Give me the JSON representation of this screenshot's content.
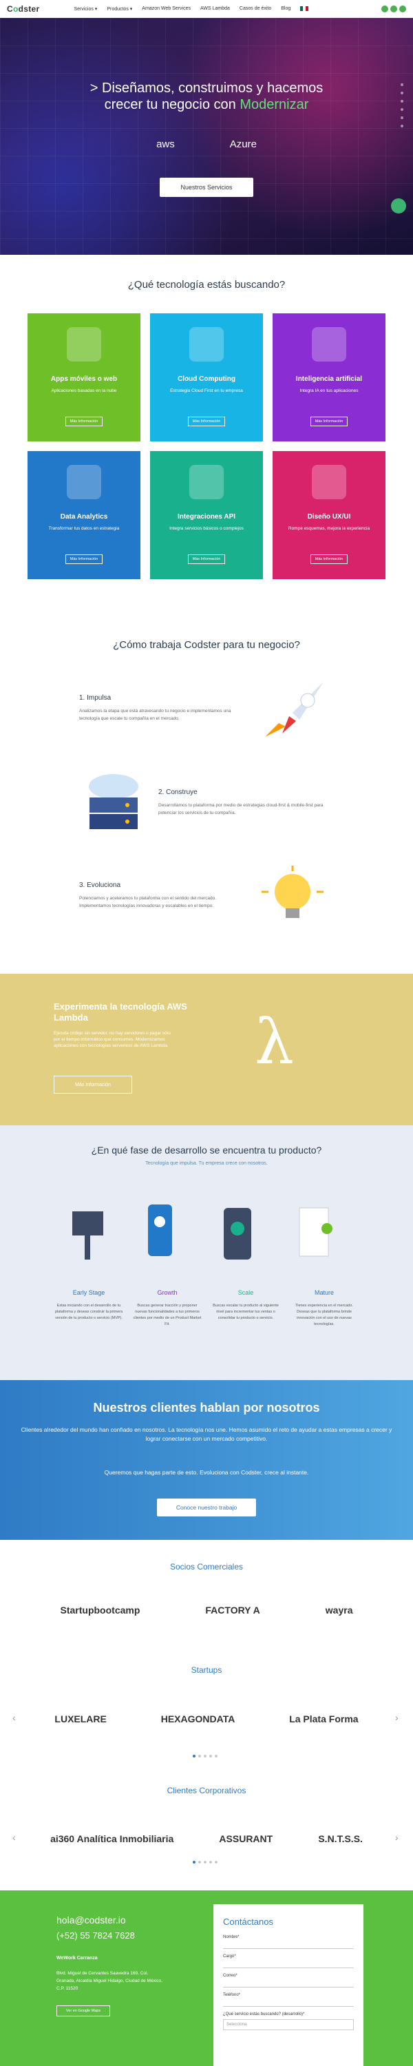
{
  "nav": {
    "logo": "Codster",
    "items": [
      "Servicios ▾",
      "Productos ▾",
      "Amazon Web Services",
      "AWS Lambda",
      "Casos de éxito",
      "Blog"
    ]
  },
  "hero": {
    "title_1": "> Diseñamos, construimos y hacemos",
    "title_2": "crecer tu negocio con ",
    "title_hl": "Modernizar",
    "logo_aws": "aws",
    "logo_azure": "Azure",
    "button": "Nuestros Servicios"
  },
  "tech": {
    "heading": "¿Qué tecnología estás buscando?",
    "cards": [
      {
        "title": "Apps móviles o web",
        "desc": "Aplicaciones basadas en la nube",
        "btn": "Más Información",
        "color": "#6fbf28"
      },
      {
        "title": "Cloud Computing",
        "desc": "Estrategia Cloud First en tu empresa",
        "btn": "Más Información",
        "color": "#18b4e6"
      },
      {
        "title": "Inteligencia artificial",
        "desc": "Integra IA en tus aplicaciones",
        "btn": "Más Información",
        "color": "#8a2ed3"
      },
      {
        "title": "Data Analytics",
        "desc": "Transformar tus datos en estrategia",
        "btn": "Más Información",
        "color": "#2278c9"
      },
      {
        "title": "Integraciones API",
        "desc": "Integra servicios básicos o complejos",
        "btn": "Más Información",
        "color": "#19b08e"
      },
      {
        "title": "Diseño UX/UI",
        "desc": "Rompe esquemas, mejora la experiencia",
        "btn": "Más Información",
        "color": "#d8236b"
      }
    ]
  },
  "how": {
    "heading": "¿Cómo trabaja Codster para tu negocio?",
    "steps": [
      {
        "title": "1. Impulsa",
        "desc": "Analizamos la etapa que está atravesando tu negocio e implementamos una tecnología que escale tu compañía en el mercado."
      },
      {
        "title": "2. Construye",
        "desc": "Desarrollamos tu plataforma por medio de estrategias cloud-first & mobile-first para potenciar los servicios de tu compañía."
      },
      {
        "title": "3. Evoluciona",
        "desc": "Potenciamos y aceleramos tu plataforma con el sentido del mercado. Implementamos tecnologías innovadoras y escalables en el tiempo."
      }
    ]
  },
  "lambda": {
    "title": "Experimenta la tecnología AWS Lambda",
    "desc": "Ejecuta código sin servidor, no hay servidores o pagar sólo por el tiempo informático que consumes. Modernizamos aplicaciones con tecnologías serverless de AWS Lambda.",
    "btn": "Más Información",
    "symbol": "λ"
  },
  "phase": {
    "heading": "¿En qué fase de desarrollo se encuentra tu producto?",
    "sub": "Tecnología que impulsa. Tu empresa crece con nosotros.",
    "cols": [
      {
        "title": "Early Stage",
        "desc": "Estas iniciando con el desarrollo de tu plataforma y deseas construir la primera versión de tu producto o servicio (MVP).",
        "color": "#2278c9"
      },
      {
        "title": "Growth",
        "desc": "Buscas generar tracción y proponer nuevas funcionalidades a tus primeros clientes por medio de un Product Market Fit.",
        "color": "#8a2ed3"
      },
      {
        "title": "Scale",
        "desc": "Buscas escalar tu producto al siguiente nivel para incrementar tus ventas o consolidar tu producto o servicio.",
        "color": "#19b08e"
      },
      {
        "title": "Mature",
        "desc": "Tienes experiencia en el mercado. Deseas que tu plataforma brinde innovación con el uso de nuevas tecnologías.",
        "color": "#2278c9"
      }
    ]
  },
  "clients": {
    "heading": "Nuestros clientes hablan por nosotros",
    "p1": "Clientes alrededor del mundo han confiado en nosotros. La tecnología nos une. Hemos asumido el reto de ayudar a estas empresas a crecer y lograr conectarse con un mercado competitivo.",
    "p2": "Queremos que hagas parte de esto. Evoluciona con Codster, crece al instante.",
    "btn": "Conoce nuestro trabajo"
  },
  "partners": {
    "label": "Socios Comerciales",
    "logos": [
      "Startupbootcamp",
      "FACTORY A",
      "wayra"
    ]
  },
  "startups": {
    "label": "Startups",
    "logos": [
      "LUXELARE",
      "HEXAGONDATA",
      "La Plata Forma"
    ]
  },
  "corporate": {
    "label": "Clientes Corporativos",
    "logos": [
      "ai360 Analítica Inmobiliaria",
      "ASSURANT",
      "S.N.T.S.S."
    ]
  },
  "footer": {
    "email": "hola@codster.io",
    "phone": "(+52) 55 7824 7628",
    "office_title": "WeWork Carranza",
    "address": "Blvd. Miguel de Cervantes Saavedra 169, Col. Granada, Alcaldía Miguel Hidalgo, Ciudad de México, C.P. 11520",
    "map_btn": "Ver en Google Maps",
    "form": {
      "title": "Contáctanos",
      "fields": [
        "Nombre*",
        "Cargo*",
        "Correo*",
        "Teléfono*",
        "¿Qué servicio estás buscando? (desarrollo)*"
      ],
      "select_placeholder": "Selecciona"
    }
  }
}
